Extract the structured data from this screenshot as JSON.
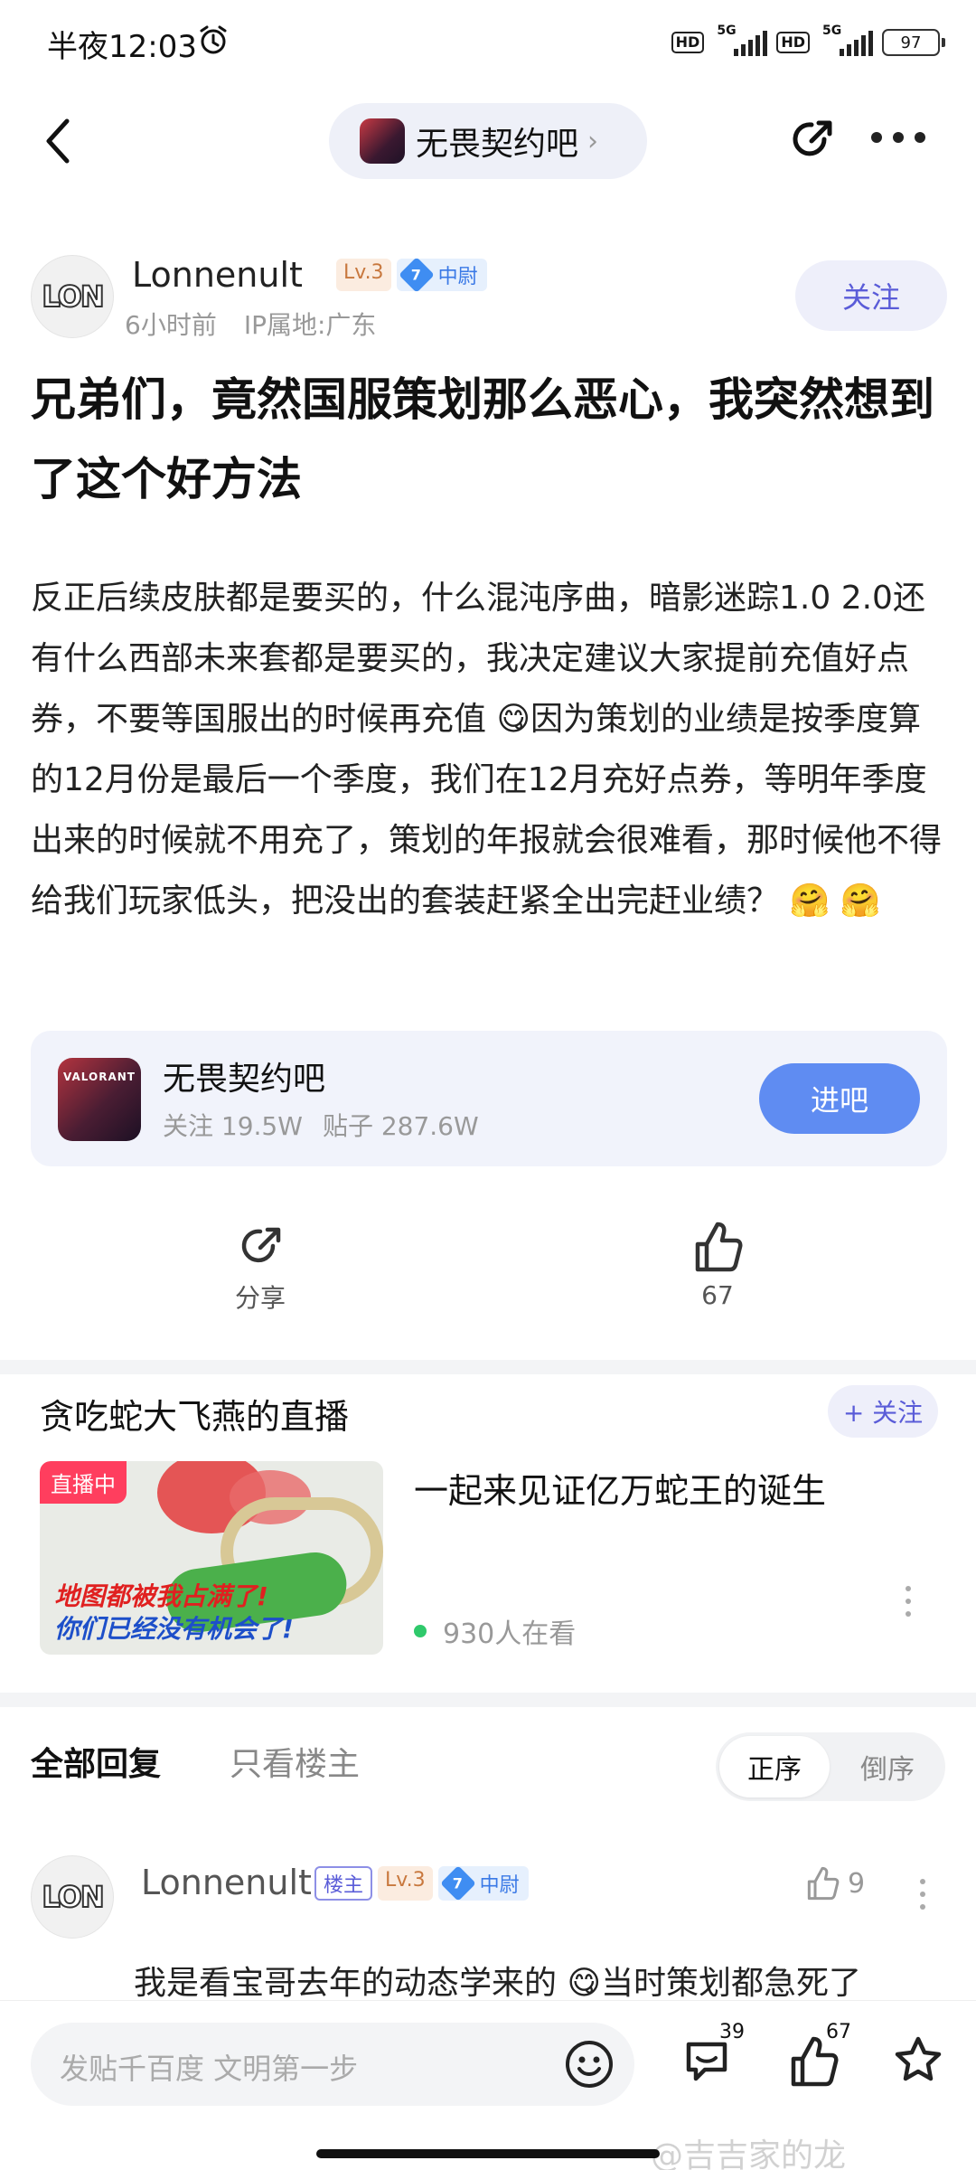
{
  "status": {
    "time": "半夜12:03",
    "net1": "5G",
    "net2": "5G",
    "hd": "HD",
    "battery": "97"
  },
  "nav": {
    "forum_name": "无畏契约吧"
  },
  "post": {
    "author": "Lonnenult",
    "level": "Lv.3",
    "rank_num": "7",
    "rank": "中尉",
    "time": "6小时前",
    "ip": "IP属地:广东",
    "follow": "关注",
    "title": "兄弟们，竟然国服策划那么恶心，我突然想到了这个好方法",
    "body": "反正后续皮肤都是要买的，什么混沌序曲，暗影迷踪1.0 2.0还有什么西部未来套都是要买的，我决定建议大家提前充值好点券，不要等国服出的时候再充值 😋因为策划的业绩是按季度算的12月份是最后一个季度，我们在12月充好点券，等明年季度出来的时候就不用充了，策划的年报就会很难看，那时候他不得给我们玩家低头，把没出的套装赶紧全出完赶业绩？ 🤗 🤗"
  },
  "forum_card": {
    "logo": "VALORANT",
    "name": "无畏契约吧",
    "followers": "关注 19.5W",
    "posts": "贴子 287.6W",
    "enter": "进吧"
  },
  "actions": {
    "share": "分享",
    "likes": "67"
  },
  "live": {
    "title": "贪吃蛇大飞燕的直播",
    "follow": "+ 关注",
    "badge": "直播中",
    "caption1": "地图都被我占满了!",
    "caption2": "你们已经没有机会了!",
    "name": "一起来见证亿万蛇王的诞生",
    "viewers": "930人在看"
  },
  "replies": {
    "tab_all": "全部回复",
    "tab_op": "只看楼主",
    "sort_asc": "正序",
    "sort_desc": "倒序",
    "first": {
      "author": "Lonnenult",
      "op_tag": "楼主",
      "level": "Lv.3",
      "rank_num": "7",
      "rank": "中尉",
      "likes": "9",
      "text": "我是看宝哥去年的动态学来的 😋当时策划都急死了"
    }
  },
  "bottom": {
    "placeholder": "发贴千百度 文明第一步",
    "comments": "39",
    "likes": "67",
    "watermark": "@吉吉家的龙"
  },
  "colors": {
    "accent": "#5f8cf2",
    "follow_text": "#5a5cd8",
    "live_badge": "#ff3e5e"
  }
}
